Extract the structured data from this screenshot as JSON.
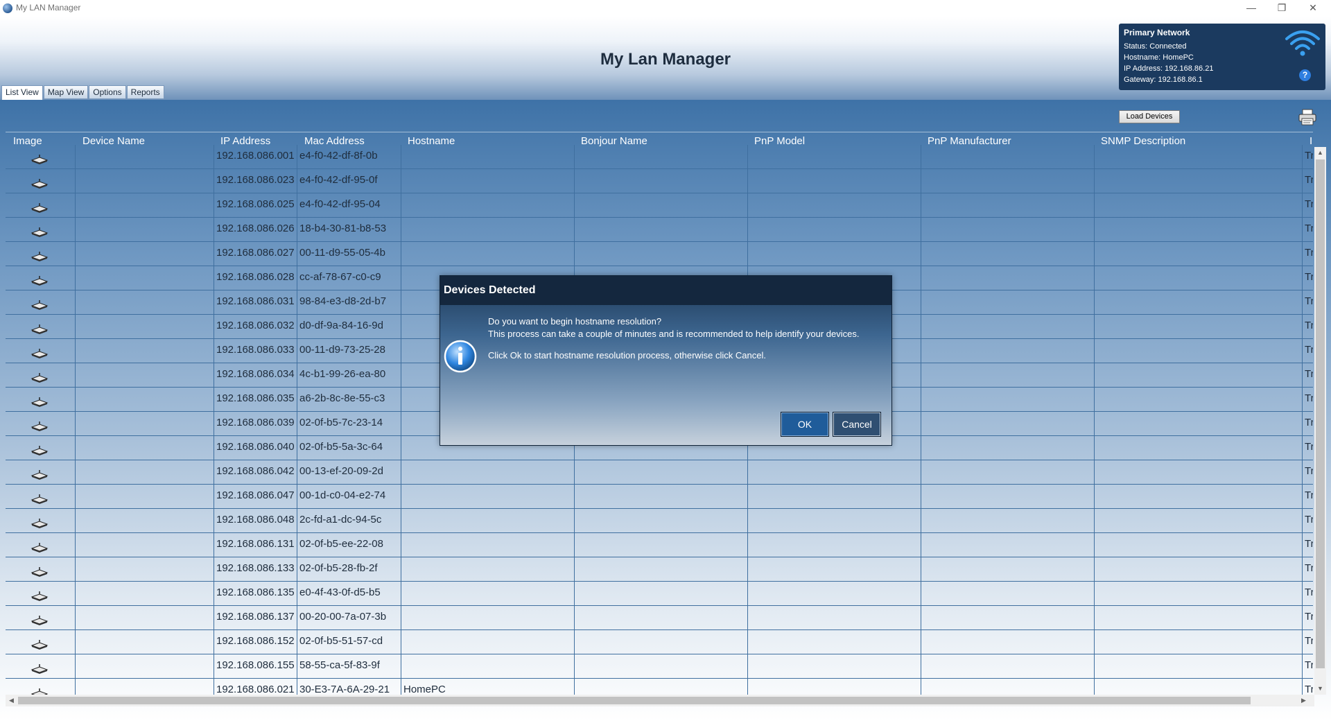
{
  "window": {
    "title": "My LAN Manager",
    "controls": {
      "minimize": "—",
      "maximize": "❐",
      "close": "✕"
    }
  },
  "header": {
    "title": "My Lan Manager"
  },
  "tabs": [
    {
      "label": "List View",
      "active": true
    },
    {
      "label": "Map View",
      "active": false
    },
    {
      "label": "Options",
      "active": false
    },
    {
      "label": "Reports",
      "active": false
    }
  ],
  "network": {
    "title": "Primary Network",
    "status": "Status: Connected",
    "hostname": "Hostname: HomePC",
    "ip": "IP Address: 192.168.86.21",
    "gateway": "Gateway: 192.168.86.1",
    "help": "?",
    "wifi_icon": "wifi-icon",
    "color": "#1b3a5f"
  },
  "toolbar": {
    "load_devices": "Load Devices",
    "print_icon": "printer-icon"
  },
  "grid": {
    "columns": [
      "Image",
      "Device Name",
      "IP Address",
      "Mac Address",
      "Hostname",
      "Bonjour Name",
      "PnP Model",
      "PnP Manufacturer",
      "SNMP Description",
      "I"
    ],
    "rows": [
      {
        "ip": "192.168.086.001",
        "mac": "e4-f0-42-df-8f-0b",
        "hostname": "",
        "last": "Tr"
      },
      {
        "ip": "192.168.086.023",
        "mac": "e4-f0-42-df-95-0f",
        "hostname": "",
        "last": "Tr"
      },
      {
        "ip": "192.168.086.025",
        "mac": "e4-f0-42-df-95-04",
        "hostname": "",
        "last": "Tr"
      },
      {
        "ip": "192.168.086.026",
        "mac": "18-b4-30-81-b8-53",
        "hostname": "",
        "last": "Tr"
      },
      {
        "ip": "192.168.086.027",
        "mac": "00-11-d9-55-05-4b",
        "hostname": "",
        "last": "Tr"
      },
      {
        "ip": "192.168.086.028",
        "mac": "cc-af-78-67-c0-c9",
        "hostname": "",
        "last": "Tr"
      },
      {
        "ip": "192.168.086.031",
        "mac": "98-84-e3-d8-2d-b7",
        "hostname": "",
        "last": "Tr"
      },
      {
        "ip": "192.168.086.032",
        "mac": "d0-df-9a-84-16-9d",
        "hostname": "",
        "last": "Tr"
      },
      {
        "ip": "192.168.086.033",
        "mac": "00-11-d9-73-25-28",
        "hostname": "",
        "last": "Tr"
      },
      {
        "ip": "192.168.086.034",
        "mac": "4c-b1-99-26-ea-80",
        "hostname": "",
        "last": "Tr"
      },
      {
        "ip": "192.168.086.035",
        "mac": "a6-2b-8c-8e-55-c3",
        "hostname": "",
        "last": "Tr"
      },
      {
        "ip": "192.168.086.039",
        "mac": "02-0f-b5-7c-23-14",
        "hostname": "",
        "last": "Tr"
      },
      {
        "ip": "192.168.086.040",
        "mac": "02-0f-b5-5a-3c-64",
        "hostname": "",
        "last": "Tr"
      },
      {
        "ip": "192.168.086.042",
        "mac": "00-13-ef-20-09-2d",
        "hostname": "",
        "last": "Tr"
      },
      {
        "ip": "192.168.086.047",
        "mac": "00-1d-c0-04-e2-74",
        "hostname": "",
        "last": "Tr"
      },
      {
        "ip": "192.168.086.048",
        "mac": "2c-fd-a1-dc-94-5c",
        "hostname": "",
        "last": "Tr"
      },
      {
        "ip": "192.168.086.131",
        "mac": "02-0f-b5-ee-22-08",
        "hostname": "",
        "last": "Tr"
      },
      {
        "ip": "192.168.086.133",
        "mac": "02-0f-b5-28-fb-2f",
        "hostname": "",
        "last": "Tr"
      },
      {
        "ip": "192.168.086.135",
        "mac": "e0-4f-43-0f-d5-b5",
        "hostname": "",
        "last": "Tr"
      },
      {
        "ip": "192.168.086.137",
        "mac": "00-20-00-7a-07-3b",
        "hostname": "",
        "last": "Tr"
      },
      {
        "ip": "192.168.086.152",
        "mac": "02-0f-b5-51-57-cd",
        "hostname": "",
        "last": "Tr"
      },
      {
        "ip": "192.168.086.155",
        "mac": "58-55-ca-5f-83-9f",
        "hostname": "",
        "last": "Tr"
      },
      {
        "ip": "192.168.086.021",
        "mac": "30-E3-7A-6A-29-21",
        "hostname": "HomePC",
        "last": "Tr"
      }
    ]
  },
  "dialog": {
    "title": "Devices Detected",
    "line1": "Do you want to begin hostname resolution?",
    "line2": "This process can take a couple of minutes and is recommended to help identify your devices.",
    "line3": "Click Ok to start hostname resolution process, otherwise click Cancel.",
    "ok": "OK",
    "cancel": "Cancel",
    "icon": "info-icon"
  },
  "scroll": {
    "up": "▲",
    "down": "▼",
    "left": "◀",
    "right": "▶"
  }
}
